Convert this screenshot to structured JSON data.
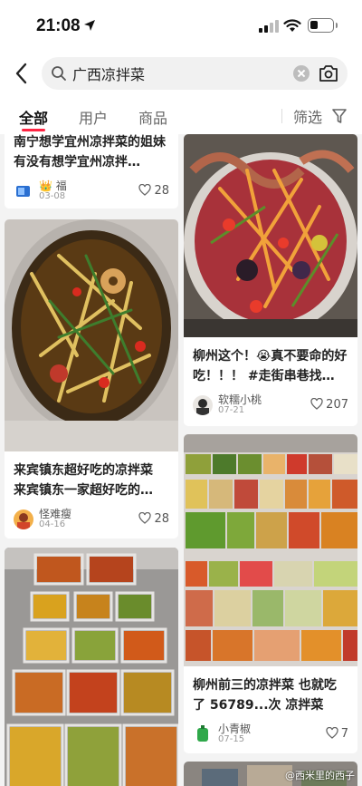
{
  "status_bar": {
    "time": "21:08",
    "battery_level": 0.35
  },
  "search": {
    "query": "广西凉拌菜",
    "placeholder": ""
  },
  "tabs": [
    {
      "label": "全部",
      "active": true
    },
    {
      "label": "用户",
      "active": false
    },
    {
      "label": "商品",
      "active": false
    }
  ],
  "filter": {
    "label": "筛选"
  },
  "left_column": [
    {
      "title": "南宁想学宜州凉拌菜的姐妹 有没有想学宜州凉拌…",
      "author": "福",
      "date": "03-08",
      "likes": "28",
      "image_desc": "top cropped"
    },
    {
      "title": "来宾镇东超好吃的凉拌菜 来宾镇东一家超好吃的…",
      "author": "怪难瘦",
      "date": "04-16",
      "likes": "28",
      "image_desc": "bowl of mixed cold dish"
    },
    {
      "title": "",
      "author": "",
      "date": "",
      "likes": "",
      "image_desc": "trays of pickled vegetables"
    }
  ],
  "right_column": [
    {
      "title": "柳州这个！😭真不要命的好吃！！！ #走街串巷找…",
      "author": "软糯小桃",
      "date": "07-21",
      "likes": "207",
      "image_desc": "spicy mixed dish in plastic bowl"
    },
    {
      "title": "柳州前三的凉拌菜 也就吃了 56789...次 凉拌菜跟…",
      "author": "小青椒",
      "date": "07-15",
      "likes": "7",
      "image_desc": "market stall with many trays"
    }
  ],
  "watermark": "@西米里的西子",
  "colors": {
    "accent": "#ff2442",
    "text": "#222222",
    "muted": "#999999",
    "background": "#f3f3f3"
  }
}
